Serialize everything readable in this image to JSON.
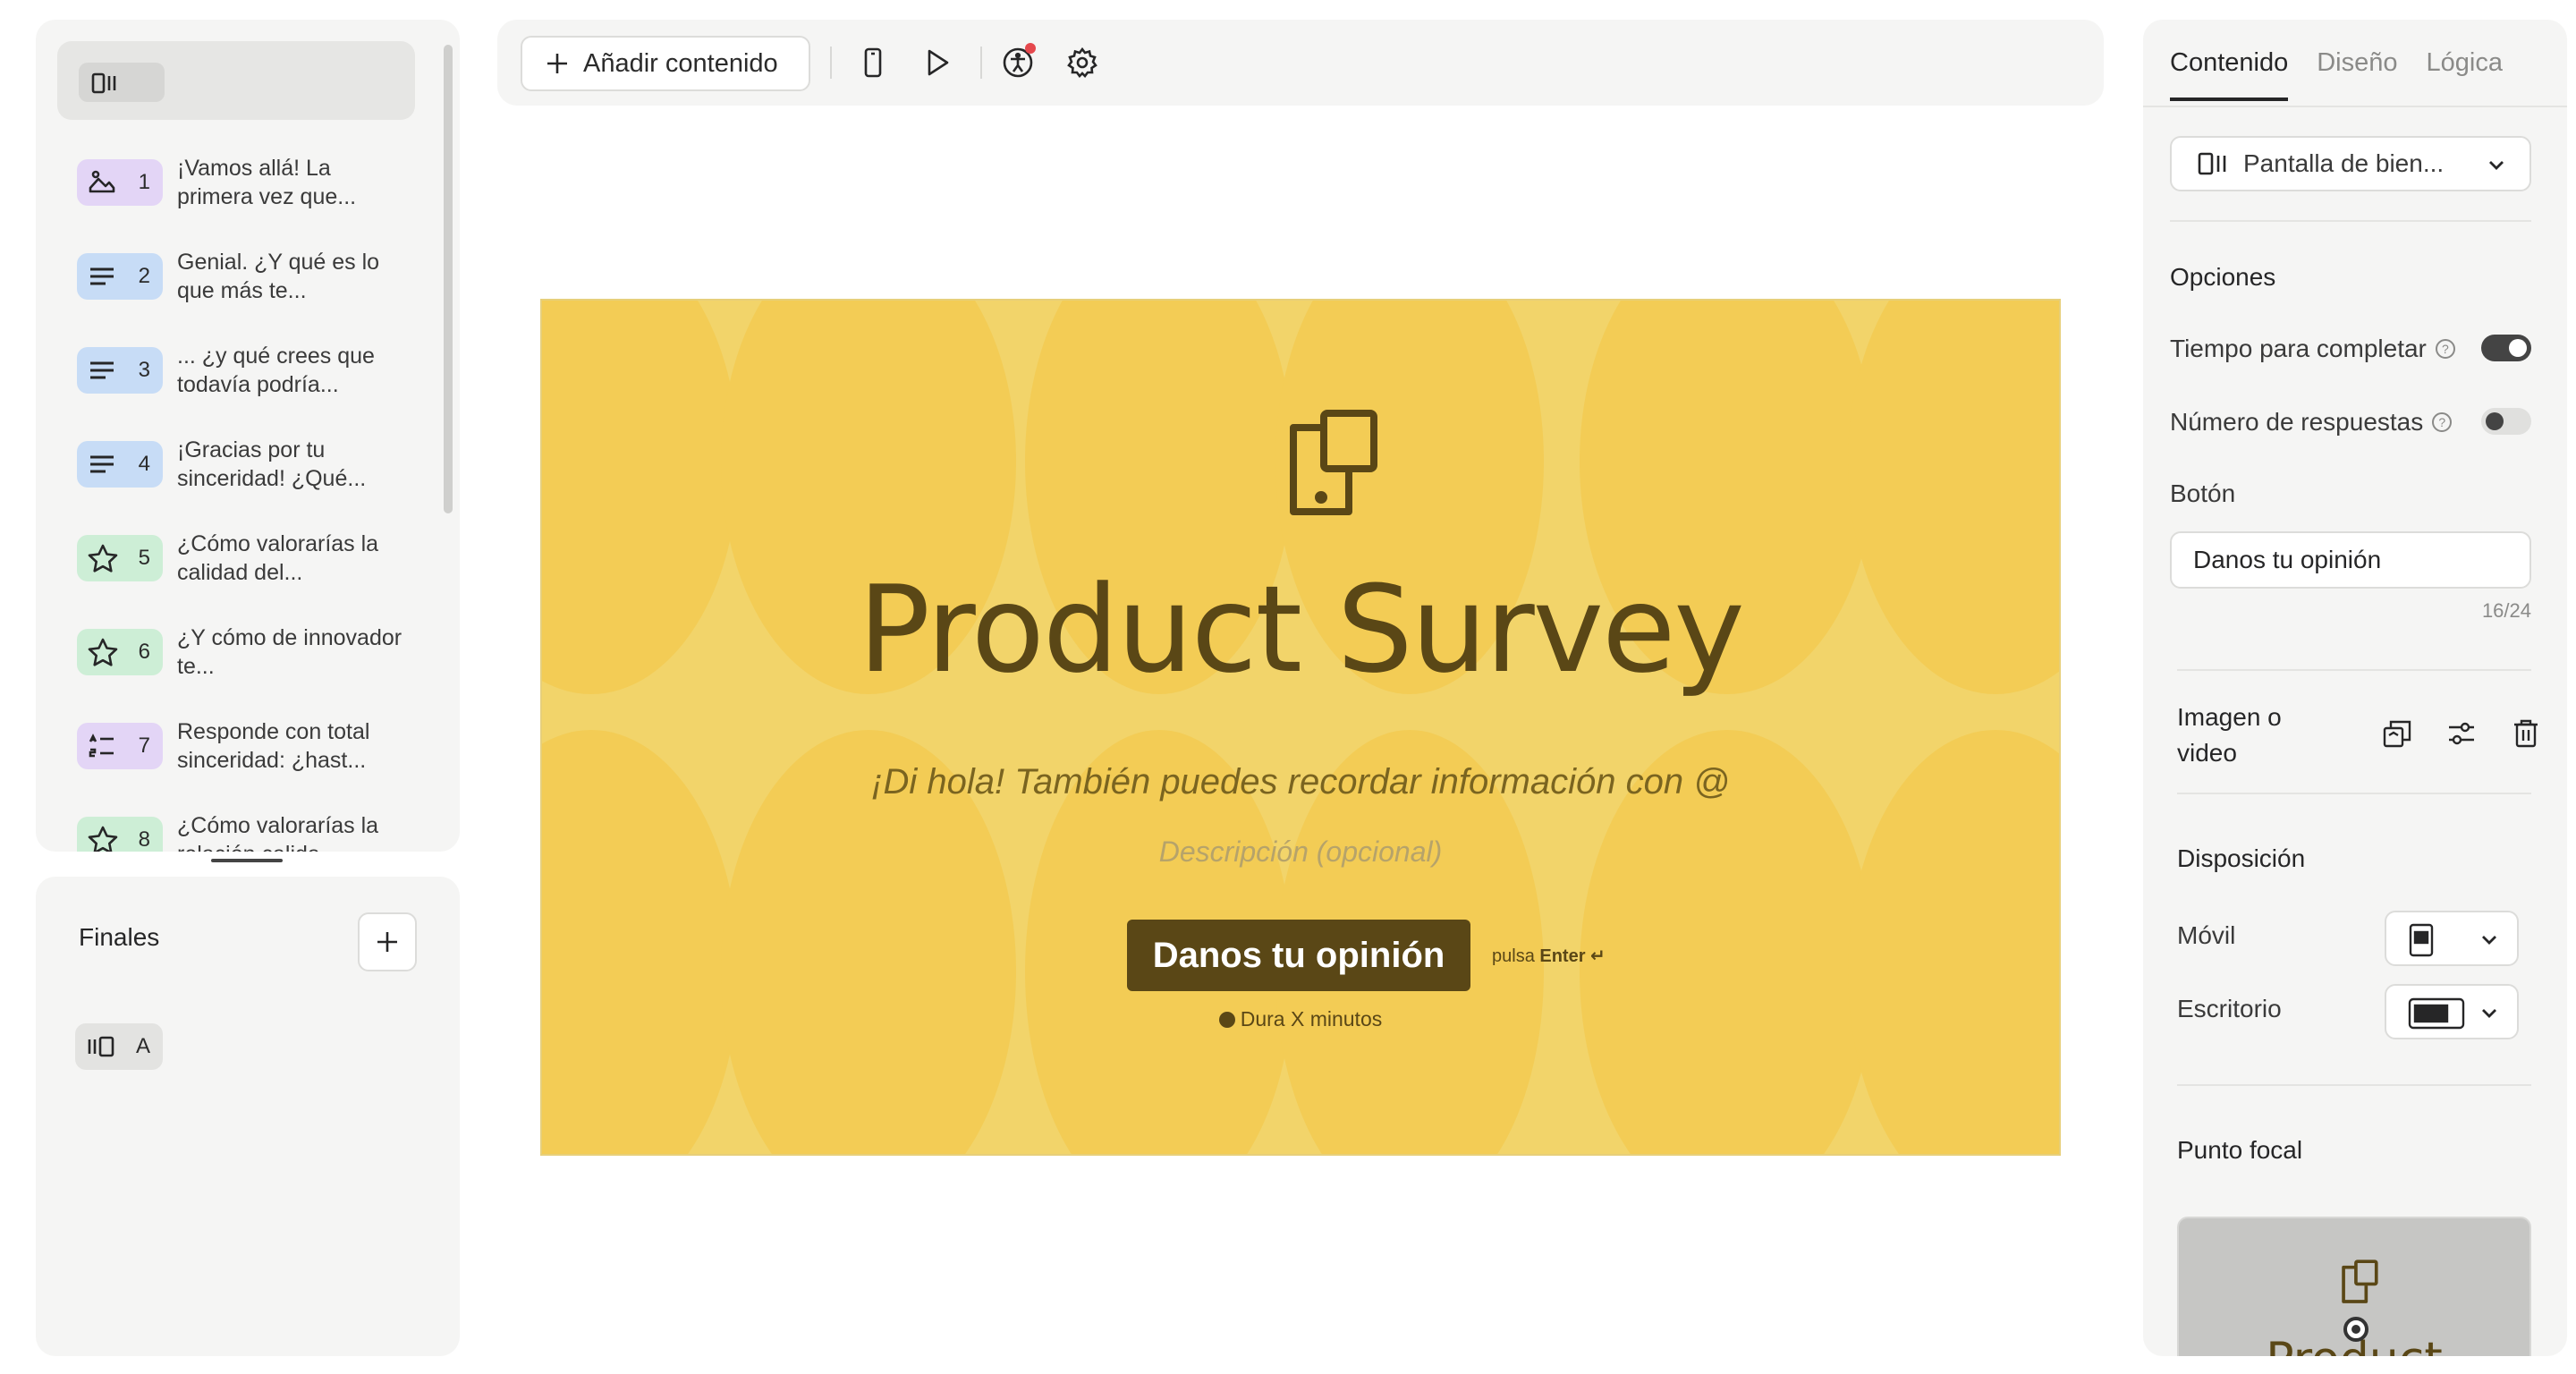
{
  "toolbar": {
    "add_content_label": "Añadir contenido"
  },
  "sidebar": {
    "questions": [
      {
        "num": "1",
        "text": "¡Vamos allá! La primera vez que...",
        "icon": "image-icon",
        "color": "#e3d5f6"
      },
      {
        "num": "2",
        "text": "Genial. ¿Y qué es lo que más te...",
        "icon": "text-lines-icon",
        "color": "#c7dcf6"
      },
      {
        "num": "3",
        "text": "... ¿y qué crees que todavía podría...",
        "icon": "text-lines-icon",
        "color": "#c7dcf6"
      },
      {
        "num": "4",
        "text": "¡Gracias por tu sinceridad! ¿Qué...",
        "icon": "text-lines-icon",
        "color": "#c7dcf6"
      },
      {
        "num": "5",
        "text": "¿Cómo valorarías la calidad del...",
        "icon": "star-icon",
        "color": "#cdeed6"
      },
      {
        "num": "6",
        "text": "¿Y cómo de innovador te...",
        "icon": "star-icon",
        "color": "#cdeed6"
      },
      {
        "num": "7",
        "text": "Responde con total sinceridad: ¿hast...",
        "icon": "ranking-icon",
        "color": "#e3d5f6"
      },
      {
        "num": "8",
        "text": "¿Cómo valorarías la relación calida...",
        "icon": "star-icon",
        "color": "#cdeed6"
      }
    ],
    "finales_title": "Finales",
    "final_item_label": "A"
  },
  "preview": {
    "title": "Product Survey",
    "subtitle": "¡Di hola! También puedes recordar información con @",
    "description_placeholder": "Descripción (opcional)",
    "cta_label": "Danos tu opinión",
    "enter_prefix": "pulsa",
    "enter_key": "Enter ↵",
    "duration": "Dura X minutos",
    "bg_color": "#f2d46a",
    "button_color": "#5a4716"
  },
  "right_panel": {
    "tabs": [
      "Contenido",
      "Diseño",
      "Lógica"
    ],
    "screen_select": "Pantalla de bien...",
    "options_title": "Opciones",
    "time_option": "Tiempo para completar",
    "time_enabled": true,
    "responses_option": "Número de respuestas",
    "responses_enabled": false,
    "button_section": "Botón",
    "button_value": "Danos tu opinión",
    "char_counter": "16/24",
    "media_label": "Imagen o video",
    "layout_title": "Disposición",
    "mobile_label": "Móvil",
    "desktop_label": "Escritorio",
    "focal_title": "Punto focal",
    "focal_preview_title": "Product Survey"
  }
}
